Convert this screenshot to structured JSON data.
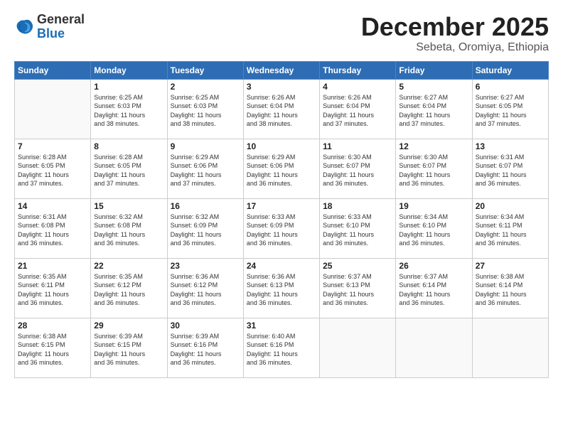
{
  "logo": {
    "general": "General",
    "blue": "Blue"
  },
  "header": {
    "month": "December 2025",
    "location": "Sebeta, Oromiya, Ethiopia"
  },
  "weekdays": [
    "Sunday",
    "Monday",
    "Tuesday",
    "Wednesday",
    "Thursday",
    "Friday",
    "Saturday"
  ],
  "weeks": [
    [
      {
        "day": "",
        "info": ""
      },
      {
        "day": "1",
        "info": "Sunrise: 6:25 AM\nSunset: 6:03 PM\nDaylight: 11 hours\nand 38 minutes."
      },
      {
        "day": "2",
        "info": "Sunrise: 6:25 AM\nSunset: 6:03 PM\nDaylight: 11 hours\nand 38 minutes."
      },
      {
        "day": "3",
        "info": "Sunrise: 6:26 AM\nSunset: 6:04 PM\nDaylight: 11 hours\nand 38 minutes."
      },
      {
        "day": "4",
        "info": "Sunrise: 6:26 AM\nSunset: 6:04 PM\nDaylight: 11 hours\nand 37 minutes."
      },
      {
        "day": "5",
        "info": "Sunrise: 6:27 AM\nSunset: 6:04 PM\nDaylight: 11 hours\nand 37 minutes."
      },
      {
        "day": "6",
        "info": "Sunrise: 6:27 AM\nSunset: 6:05 PM\nDaylight: 11 hours\nand 37 minutes."
      }
    ],
    [
      {
        "day": "7",
        "info": "Sunrise: 6:28 AM\nSunset: 6:05 PM\nDaylight: 11 hours\nand 37 minutes."
      },
      {
        "day": "8",
        "info": "Sunrise: 6:28 AM\nSunset: 6:05 PM\nDaylight: 11 hours\nand 37 minutes."
      },
      {
        "day": "9",
        "info": "Sunrise: 6:29 AM\nSunset: 6:06 PM\nDaylight: 11 hours\nand 37 minutes."
      },
      {
        "day": "10",
        "info": "Sunrise: 6:29 AM\nSunset: 6:06 PM\nDaylight: 11 hours\nand 36 minutes."
      },
      {
        "day": "11",
        "info": "Sunrise: 6:30 AM\nSunset: 6:07 PM\nDaylight: 11 hours\nand 36 minutes."
      },
      {
        "day": "12",
        "info": "Sunrise: 6:30 AM\nSunset: 6:07 PM\nDaylight: 11 hours\nand 36 minutes."
      },
      {
        "day": "13",
        "info": "Sunrise: 6:31 AM\nSunset: 6:07 PM\nDaylight: 11 hours\nand 36 minutes."
      }
    ],
    [
      {
        "day": "14",
        "info": "Sunrise: 6:31 AM\nSunset: 6:08 PM\nDaylight: 11 hours\nand 36 minutes."
      },
      {
        "day": "15",
        "info": "Sunrise: 6:32 AM\nSunset: 6:08 PM\nDaylight: 11 hours\nand 36 minutes."
      },
      {
        "day": "16",
        "info": "Sunrise: 6:32 AM\nSunset: 6:09 PM\nDaylight: 11 hours\nand 36 minutes."
      },
      {
        "day": "17",
        "info": "Sunrise: 6:33 AM\nSunset: 6:09 PM\nDaylight: 11 hours\nand 36 minutes."
      },
      {
        "day": "18",
        "info": "Sunrise: 6:33 AM\nSunset: 6:10 PM\nDaylight: 11 hours\nand 36 minutes."
      },
      {
        "day": "19",
        "info": "Sunrise: 6:34 AM\nSunset: 6:10 PM\nDaylight: 11 hours\nand 36 minutes."
      },
      {
        "day": "20",
        "info": "Sunrise: 6:34 AM\nSunset: 6:11 PM\nDaylight: 11 hours\nand 36 minutes."
      }
    ],
    [
      {
        "day": "21",
        "info": "Sunrise: 6:35 AM\nSunset: 6:11 PM\nDaylight: 11 hours\nand 36 minutes."
      },
      {
        "day": "22",
        "info": "Sunrise: 6:35 AM\nSunset: 6:12 PM\nDaylight: 11 hours\nand 36 minutes."
      },
      {
        "day": "23",
        "info": "Sunrise: 6:36 AM\nSunset: 6:12 PM\nDaylight: 11 hours\nand 36 minutes."
      },
      {
        "day": "24",
        "info": "Sunrise: 6:36 AM\nSunset: 6:13 PM\nDaylight: 11 hours\nand 36 minutes."
      },
      {
        "day": "25",
        "info": "Sunrise: 6:37 AM\nSunset: 6:13 PM\nDaylight: 11 hours\nand 36 minutes."
      },
      {
        "day": "26",
        "info": "Sunrise: 6:37 AM\nSunset: 6:14 PM\nDaylight: 11 hours\nand 36 minutes."
      },
      {
        "day": "27",
        "info": "Sunrise: 6:38 AM\nSunset: 6:14 PM\nDaylight: 11 hours\nand 36 minutes."
      }
    ],
    [
      {
        "day": "28",
        "info": "Sunrise: 6:38 AM\nSunset: 6:15 PM\nDaylight: 11 hours\nand 36 minutes."
      },
      {
        "day": "29",
        "info": "Sunrise: 6:39 AM\nSunset: 6:15 PM\nDaylight: 11 hours\nand 36 minutes."
      },
      {
        "day": "30",
        "info": "Sunrise: 6:39 AM\nSunset: 6:16 PM\nDaylight: 11 hours\nand 36 minutes."
      },
      {
        "day": "31",
        "info": "Sunrise: 6:40 AM\nSunset: 6:16 PM\nDaylight: 11 hours\nand 36 minutes."
      },
      {
        "day": "",
        "info": ""
      },
      {
        "day": "",
        "info": ""
      },
      {
        "day": "",
        "info": ""
      }
    ]
  ]
}
